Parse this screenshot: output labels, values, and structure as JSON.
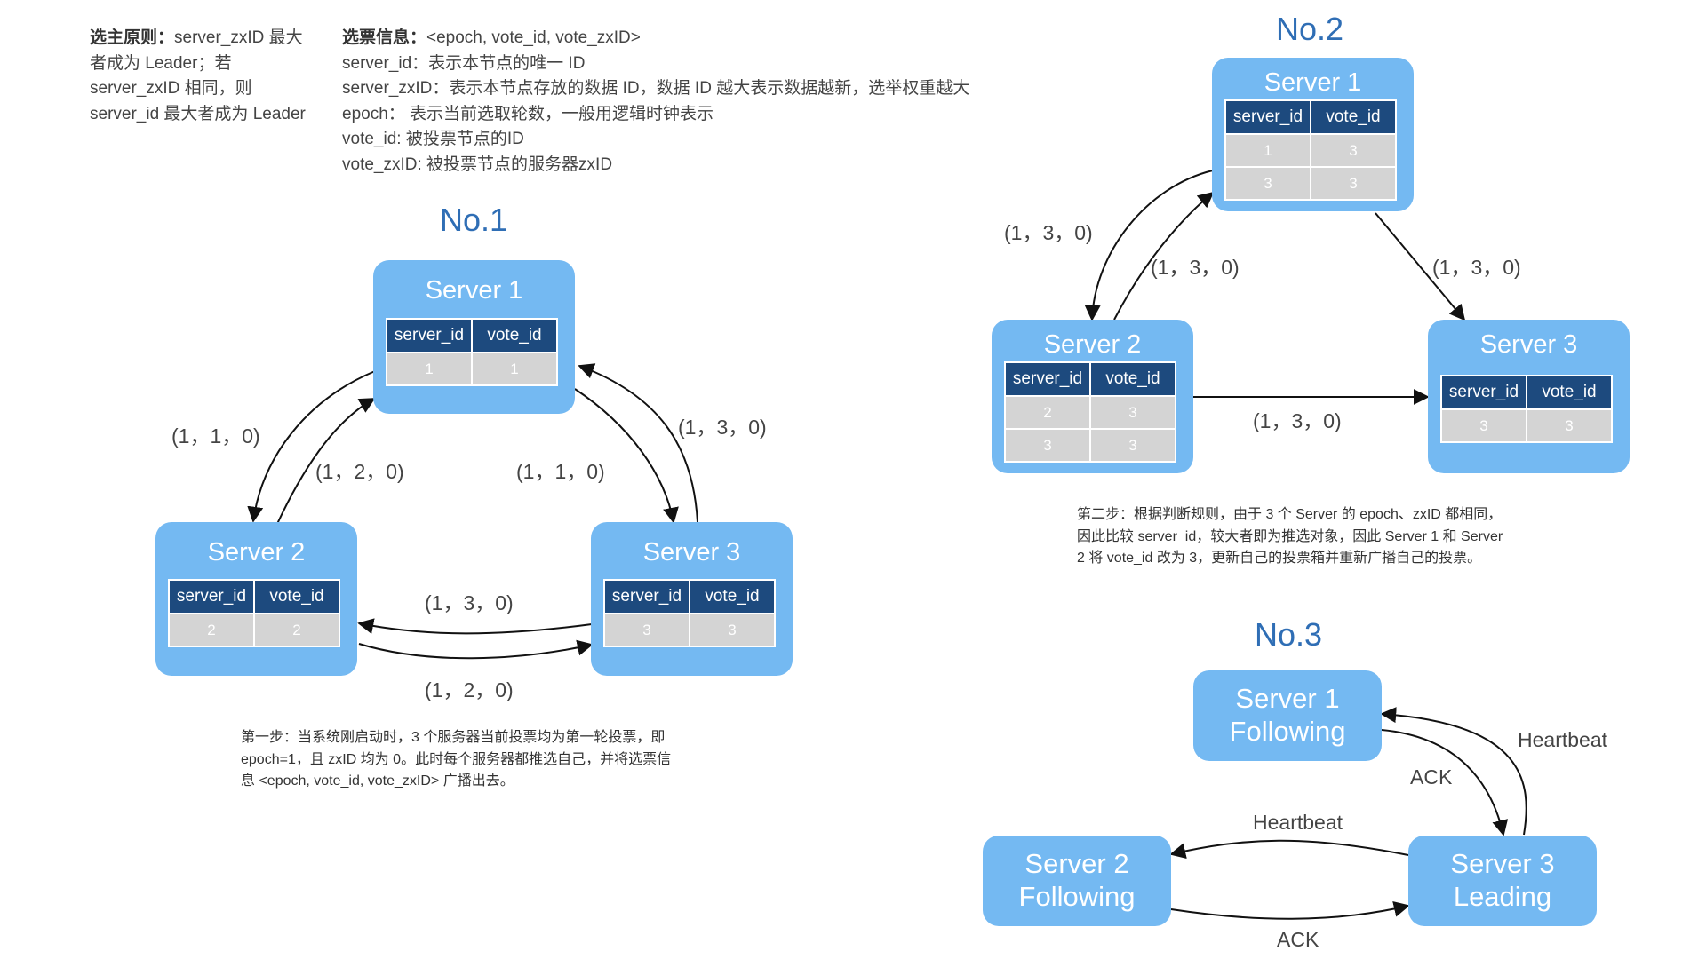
{
  "notes": {
    "principle_label": "选主原则：",
    "principle_lines": [
      "server_zxID 最大",
      "者成为 Leader；若",
      "server_zxID 相同，则",
      "server_id 最大者成为 Leader"
    ],
    "vote_label": "选票信息：",
    "vote_line0": "<epoch, vote_id, vote_zxID>",
    "vote_lines": [
      "server_id：表示本节点的唯一 ID",
      "server_zxID：表示本节点存放的数据 ID，数据 ID 越大表示数据越新，选举权重越大",
      "epoch：  表示当前选取轮数，一般用逻辑时钟表示",
      "vote_id: 被投票节点的ID",
      "vote_zxID: 被投票节点的服务器zxID"
    ]
  },
  "table_headers": {
    "server_id": "server_id",
    "vote_id": "vote_id"
  },
  "stage1": {
    "title": "No.1",
    "servers": [
      {
        "name": "Server 1",
        "rows": [
          [
            "1",
            "1"
          ]
        ]
      },
      {
        "name": "Server 2",
        "rows": [
          [
            "2",
            "2"
          ]
        ]
      },
      {
        "name": "Server 3",
        "rows": [
          [
            "3",
            "3"
          ]
        ]
      }
    ],
    "labels": {
      "s1_to_s2": "(1，1，0)",
      "s2_to_s1": "(1，2，0)",
      "s1_to_s3": "(1，1，0)",
      "s3_to_s1": "(1，3，0)",
      "s3_to_s2": "(1，3，0)",
      "s2_to_s3": "(1，2，0)"
    },
    "caption": [
      "第一步：当系统刚启动时，3 个服务器当前投票均为第一轮投票，即",
      "epoch=1，且 zxID 均为 0。此时每个服务器都推选自己，并将选票信",
      "息 <epoch, vote_id, vote_zxID> 广播出去。"
    ]
  },
  "stage2": {
    "title": "No.2",
    "servers": [
      {
        "name": "Server 1",
        "rows": [
          [
            "1",
            "3"
          ],
          [
            "3",
            "3"
          ]
        ]
      },
      {
        "name": "Server 2",
        "rows": [
          [
            "2",
            "3"
          ],
          [
            "3",
            "3"
          ]
        ]
      },
      {
        "name": "Server 3",
        "rows": [
          [
            "3",
            "3"
          ]
        ]
      }
    ],
    "labels": {
      "s1_to_s2": "(1，3，0)",
      "s2_to_s1": "(1，3，0)",
      "s1_to_s3": "(1，3，0)",
      "s2_to_s3": "(1，3，0)"
    },
    "caption": [
      "第二步：根据判断规则，由于 3 个 Server 的 epoch、zxID 都相同，",
      "因此比较 server_id，较大者即为推选对象，因此 Server 1 和 Server",
      "2 将 vote_id 改为 3，更新自己的投票箱并重新广播自己的投票。"
    ]
  },
  "stage3": {
    "title": "No.3",
    "servers": [
      {
        "name": "Server 1",
        "state": "Following"
      },
      {
        "name": "Server 2",
        "state": "Following"
      },
      {
        "name": "Server 3",
        "state": "Leading"
      }
    ],
    "labels": {
      "s3_to_s1": "Heartbeat",
      "s1_to_s3": "ACK",
      "s3_to_s2": "Heartbeat",
      "s2_to_s3": "ACK"
    }
  },
  "colors": {
    "server_fill": "#74b9f2",
    "header_fill": "#1d4a7e",
    "cell_fill": "#d4d4d4",
    "title_color": "#2f6eb5"
  }
}
